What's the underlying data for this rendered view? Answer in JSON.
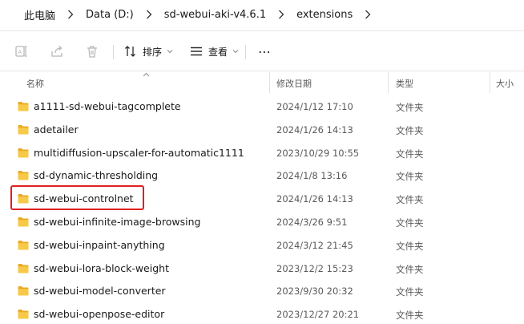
{
  "address_bar": {
    "breadcrumbs": [
      "此电脑",
      "Data (D:)",
      "sd-webui-aki-v4.6.1",
      "extensions"
    ]
  },
  "toolbar": {
    "sort_label": "排序",
    "view_label": "查看",
    "more_label": "⋯",
    "icons": [
      "rename-icon",
      "share-icon",
      "delete-icon",
      "sort-icon",
      "view-icon",
      "more-icon"
    ]
  },
  "columns": {
    "name": "名称",
    "date": "修改日期",
    "type": "类型",
    "size": "大小"
  },
  "files": [
    {
      "name": "a1111-sd-webui-tagcomplete",
      "date": "2024/1/12 17:10",
      "type": "文件夹"
    },
    {
      "name": "adetailer",
      "date": "2024/1/26 14:13",
      "type": "文件夹"
    },
    {
      "name": "multidiffusion-upscaler-for-automatic1111",
      "date": "2023/10/29 10:55",
      "type": "文件夹"
    },
    {
      "name": "sd-dynamic-thresholding",
      "date": "2024/1/8 13:16",
      "type": "文件夹"
    },
    {
      "name": "sd-webui-controlnet",
      "date": "2024/1/26 14:13",
      "type": "文件夹"
    },
    {
      "name": "sd-webui-infinite-image-browsing",
      "date": "2024/3/26 9:51",
      "type": "文件夹"
    },
    {
      "name": "sd-webui-inpaint-anything",
      "date": "2024/3/12 21:45",
      "type": "文件夹"
    },
    {
      "name": "sd-webui-lora-block-weight",
      "date": "2023/12/2 15:23",
      "type": "文件夹"
    },
    {
      "name": "sd-webui-model-converter",
      "date": "2023/9/30 20:32",
      "type": "文件夹"
    },
    {
      "name": "sd-webui-openpose-editor",
      "date": "2023/12/27 20:21",
      "type": "文件夹"
    }
  ],
  "highlighted_item": "sd-webui-controlnet",
  "colors": {
    "folder_yellow": "#f4c247",
    "highlight_red": "#e02020"
  }
}
